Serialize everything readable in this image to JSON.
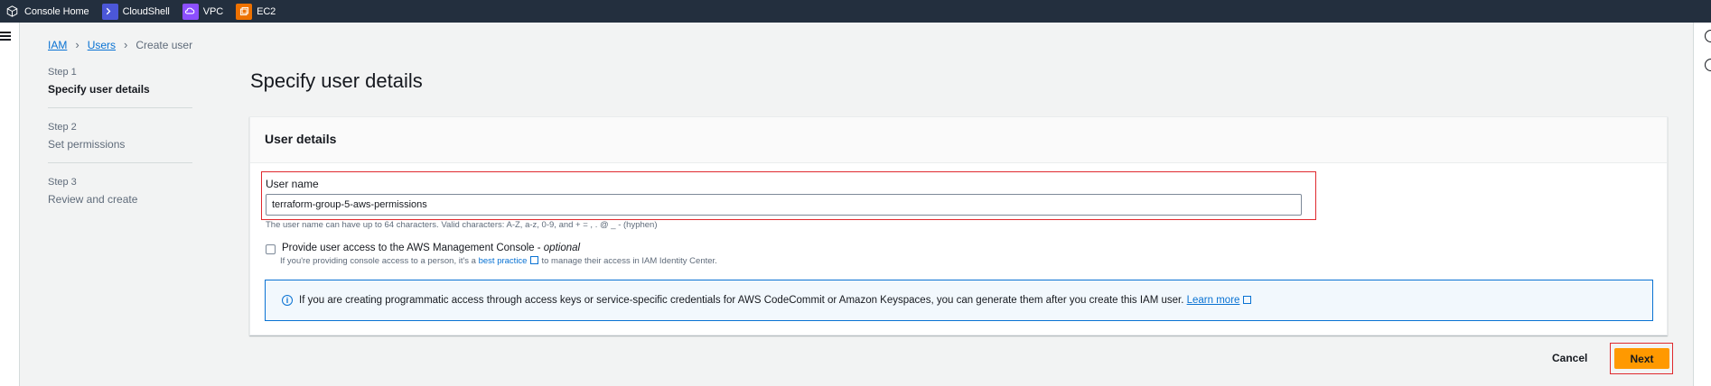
{
  "topnav": {
    "favorites": [
      {
        "label": "Console Home",
        "icon": "cube-icon"
      },
      {
        "label": "CloudShell",
        "icon": "terminal-icon"
      },
      {
        "label": "VPC",
        "icon": "vpc-icon"
      },
      {
        "label": "EC2",
        "icon": "ec2-icon"
      }
    ]
  },
  "breadcrumb": {
    "items": [
      "IAM",
      "Users"
    ],
    "current": "Create user"
  },
  "steps": [
    {
      "num": "Step 1",
      "name": "Specify user details",
      "active": true
    },
    {
      "num": "Step 2",
      "name": "Set permissions",
      "active": false
    },
    {
      "num": "Step 3",
      "name": "Review and create",
      "active": false
    }
  ],
  "page": {
    "title": "Specify user details"
  },
  "user_details": {
    "header": "User details",
    "username_label": "User name",
    "username_value": "terraform-group-5-aws-permissions",
    "username_hint": "The user name can have up to 64 characters. Valid characters: A-Z, a-z, 0-9, and + = , . @ _ - (hyphen)",
    "console_access_label": "Provide user access to the AWS Management Console - ",
    "console_access_optional": "optional",
    "console_access_desc_pre": "If you're providing console access to a person, it's a ",
    "console_access_link": "best practice",
    "console_access_desc_post": "to manage their access in IAM Identity Center.",
    "info_text": "If you are creating programmatic access through access keys or service-specific credentials for AWS CodeCommit or Amazon Keyspaces, you can generate them after you create this IAM user. ",
    "info_link": "Learn more"
  },
  "footer": {
    "cancel_label": "Cancel",
    "next_label": "Next"
  },
  "colors": {
    "topbar": "#232f3e",
    "primary_button": "#ff9900",
    "link": "#0972d3",
    "highlight_border": "#e0292e"
  }
}
